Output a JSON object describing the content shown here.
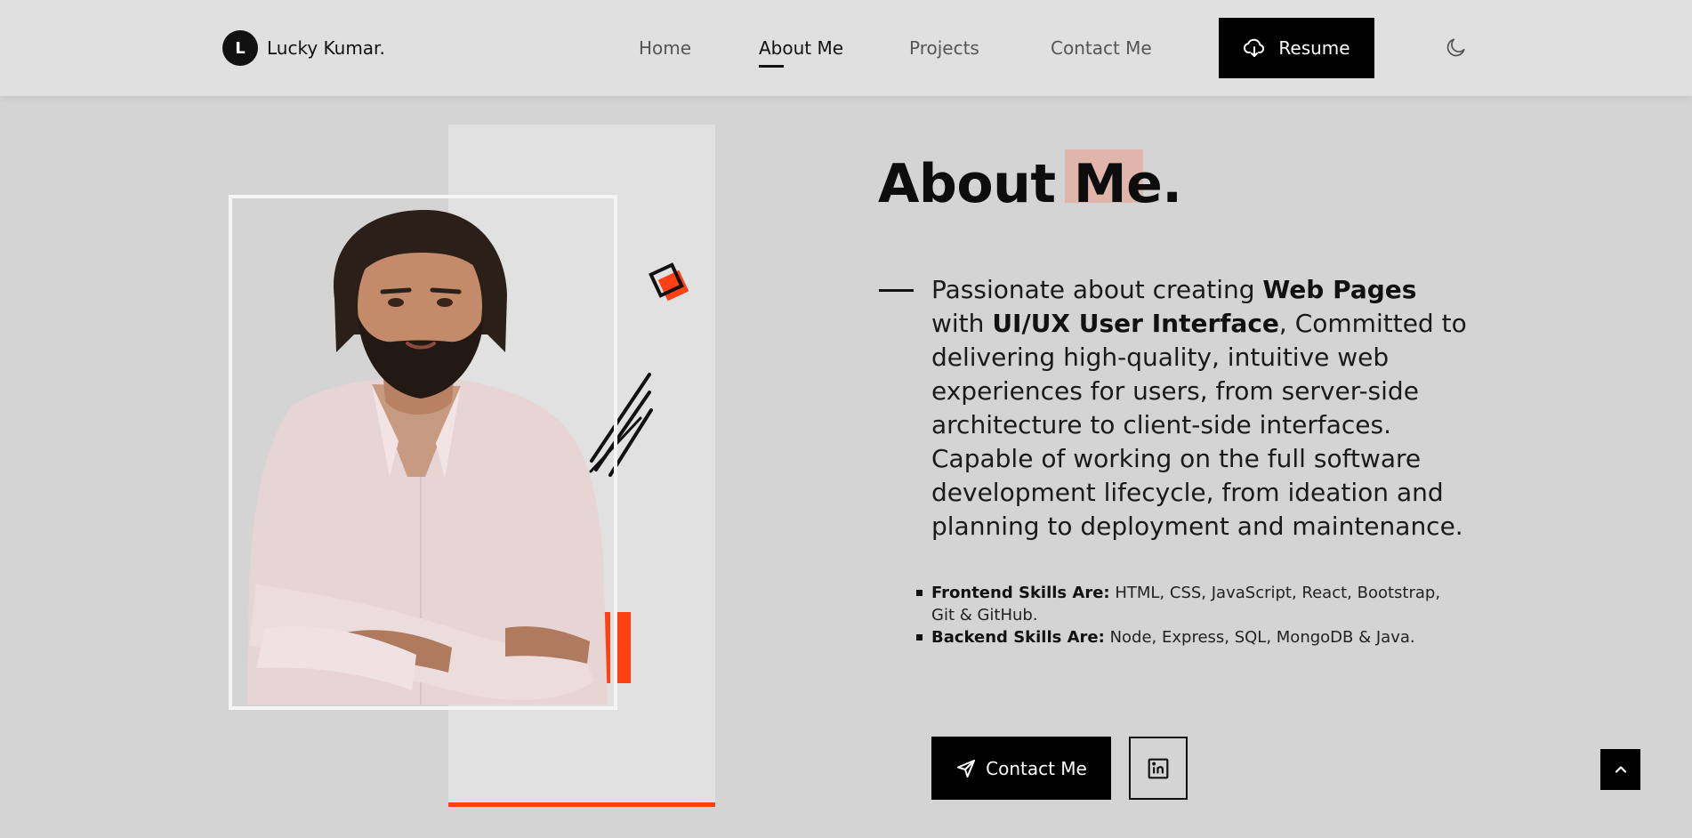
{
  "brand": {
    "logo_letter": "L",
    "name": "Lucky Kumar."
  },
  "nav": {
    "items": [
      {
        "label": "Home",
        "active": false
      },
      {
        "label": "About Me",
        "active": true
      },
      {
        "label": "Projects",
        "active": false
      },
      {
        "label": "Contact Me",
        "active": false
      }
    ],
    "resume_label": "Resume",
    "resume_icon": "cloud-download-icon",
    "theme_icon": "moon-icon"
  },
  "about": {
    "title": "About Me.",
    "description": {
      "part1": "Passionate about creating ",
      "bold1": "Web Pages",
      "part2": " with ",
      "bold2": "UI/UX User Interface",
      "part3": ", Committed to delivering high-quality, intuitive web experiences for users, from server-side architecture to client-side interfaces. Capable of working on the full software development lifecycle, from ideation and planning to deployment and maintenance."
    },
    "skills": [
      {
        "label": "Frontend Skills Are:",
        "value": " HTML, CSS, JavaScript, React, Bootstrap, Git & GitHub."
      },
      {
        "label": "Backend Skills Are:",
        "value": " Node, Express, SQL, MongoDB & Java."
      }
    ],
    "contact_label": "Contact Me",
    "contact_icon": "send-icon",
    "linkedin_icon": "linkedin-icon"
  },
  "scroll_top_icon": "chevron-up-icon",
  "colors": {
    "accent": "#ff4014",
    "accent_soft": "#e0b6ab",
    "background": "#d4d4d4",
    "header": "#e0e0e0",
    "button": "#000000"
  }
}
